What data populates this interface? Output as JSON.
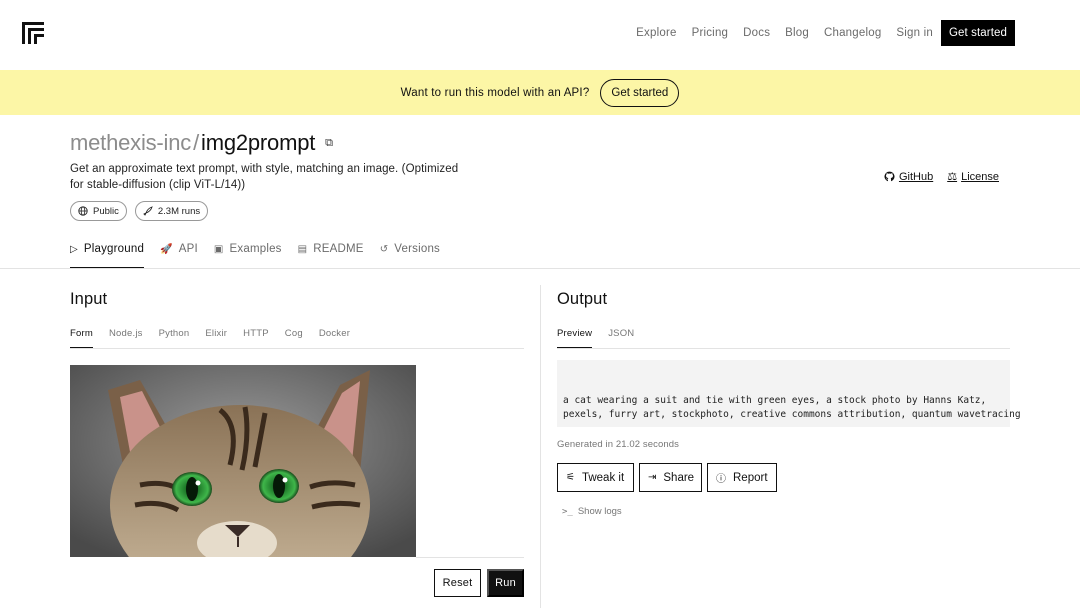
{
  "nav": {
    "links": [
      "Explore",
      "Pricing",
      "Docs",
      "Blog",
      "Changelog",
      "Sign in"
    ],
    "cta": "Get started"
  },
  "banner": {
    "text": "Want to run this model with an API?",
    "button": "Get started"
  },
  "model": {
    "owner": "methexis-inc",
    "separator": "/",
    "name": "img2prompt",
    "description": "Get an approximate text prompt, with style, matching an image. (Optimized for stable-diffusion (clip ViT-L/14))",
    "badges": [
      {
        "icon": "globe-icon",
        "label": "Public"
      },
      {
        "icon": "rocket-icon",
        "label": "2.3M runs"
      }
    ],
    "links": [
      {
        "icon": "github-icon",
        "label": "GitHub"
      },
      {
        "icon": "scale-icon",
        "label": "License"
      }
    ]
  },
  "tabs": [
    {
      "icon": "play-icon",
      "label": "Playground",
      "active": true
    },
    {
      "icon": "api-icon",
      "label": "API"
    },
    {
      "icon": "image-icon",
      "label": "Examples"
    },
    {
      "icon": "document-icon",
      "label": "README"
    },
    {
      "icon": "history-icon",
      "label": "Versions"
    }
  ],
  "input": {
    "heading": "Input",
    "subtabs": [
      "Form",
      "Node.js",
      "Python",
      "Elixir",
      "HTTP",
      "Cog",
      "Docker"
    ],
    "active_subtab": "Form",
    "reset_label": "Reset",
    "run_label": "Run"
  },
  "output": {
    "heading": "Output",
    "subtabs": [
      "Preview",
      "JSON"
    ],
    "active_subtab": "Preview",
    "text": "a cat wearing a suit and tie with green eyes, a stock photo by Hanns Katz,\npexels, furry art, stockphoto, creative commons attribution, quantum wavetracing",
    "generated": "Generated in 21.02 seconds",
    "actions": [
      {
        "icon": "sliders-icon",
        "label": "Tweak it"
      },
      {
        "icon": "share-icon",
        "label": "Share"
      },
      {
        "icon": "alert-icon",
        "label": "Report"
      }
    ],
    "logs_label": "Show logs"
  },
  "colors": {
    "banner_bg": "#fcf6a6",
    "primary": "#111111",
    "muted": "#6b6b6b",
    "output_bg": "#f3f3f3"
  }
}
